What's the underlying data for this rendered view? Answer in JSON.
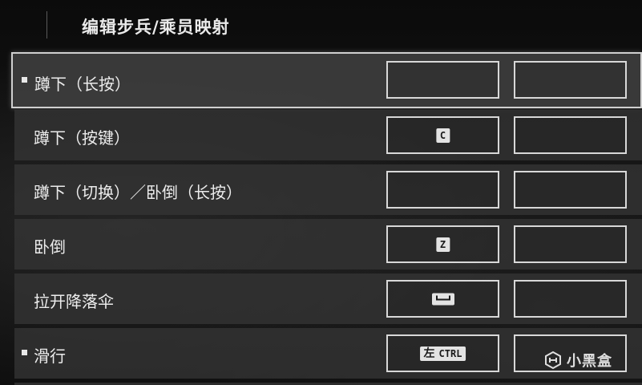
{
  "header": {
    "title": "编辑步兵/乘员映射"
  },
  "rows": [
    {
      "label": "蹲下（长按）",
      "primary_key": "",
      "secondary_key": ""
    },
    {
      "label": "蹲下（按键）",
      "primary_key": "C",
      "secondary_key": ""
    },
    {
      "label": "蹲下（切换）／卧倒（长按）",
      "primary_key": "",
      "secondary_key": ""
    },
    {
      "label": "卧倒",
      "primary_key": "Z",
      "secondary_key": ""
    },
    {
      "label": "拉开降落伞",
      "primary_key": "space-bar-icon",
      "secondary_key": ""
    },
    {
      "label": "滑行",
      "primary_key_zh": "左",
      "primary_key_en": "CTRL",
      "secondary_key": ""
    }
  ],
  "watermark": {
    "text": "小黑盒"
  },
  "colors": {
    "row_bg": "#343434",
    "border": "#d8d8d8",
    "keycap": "#e3e3e3"
  }
}
